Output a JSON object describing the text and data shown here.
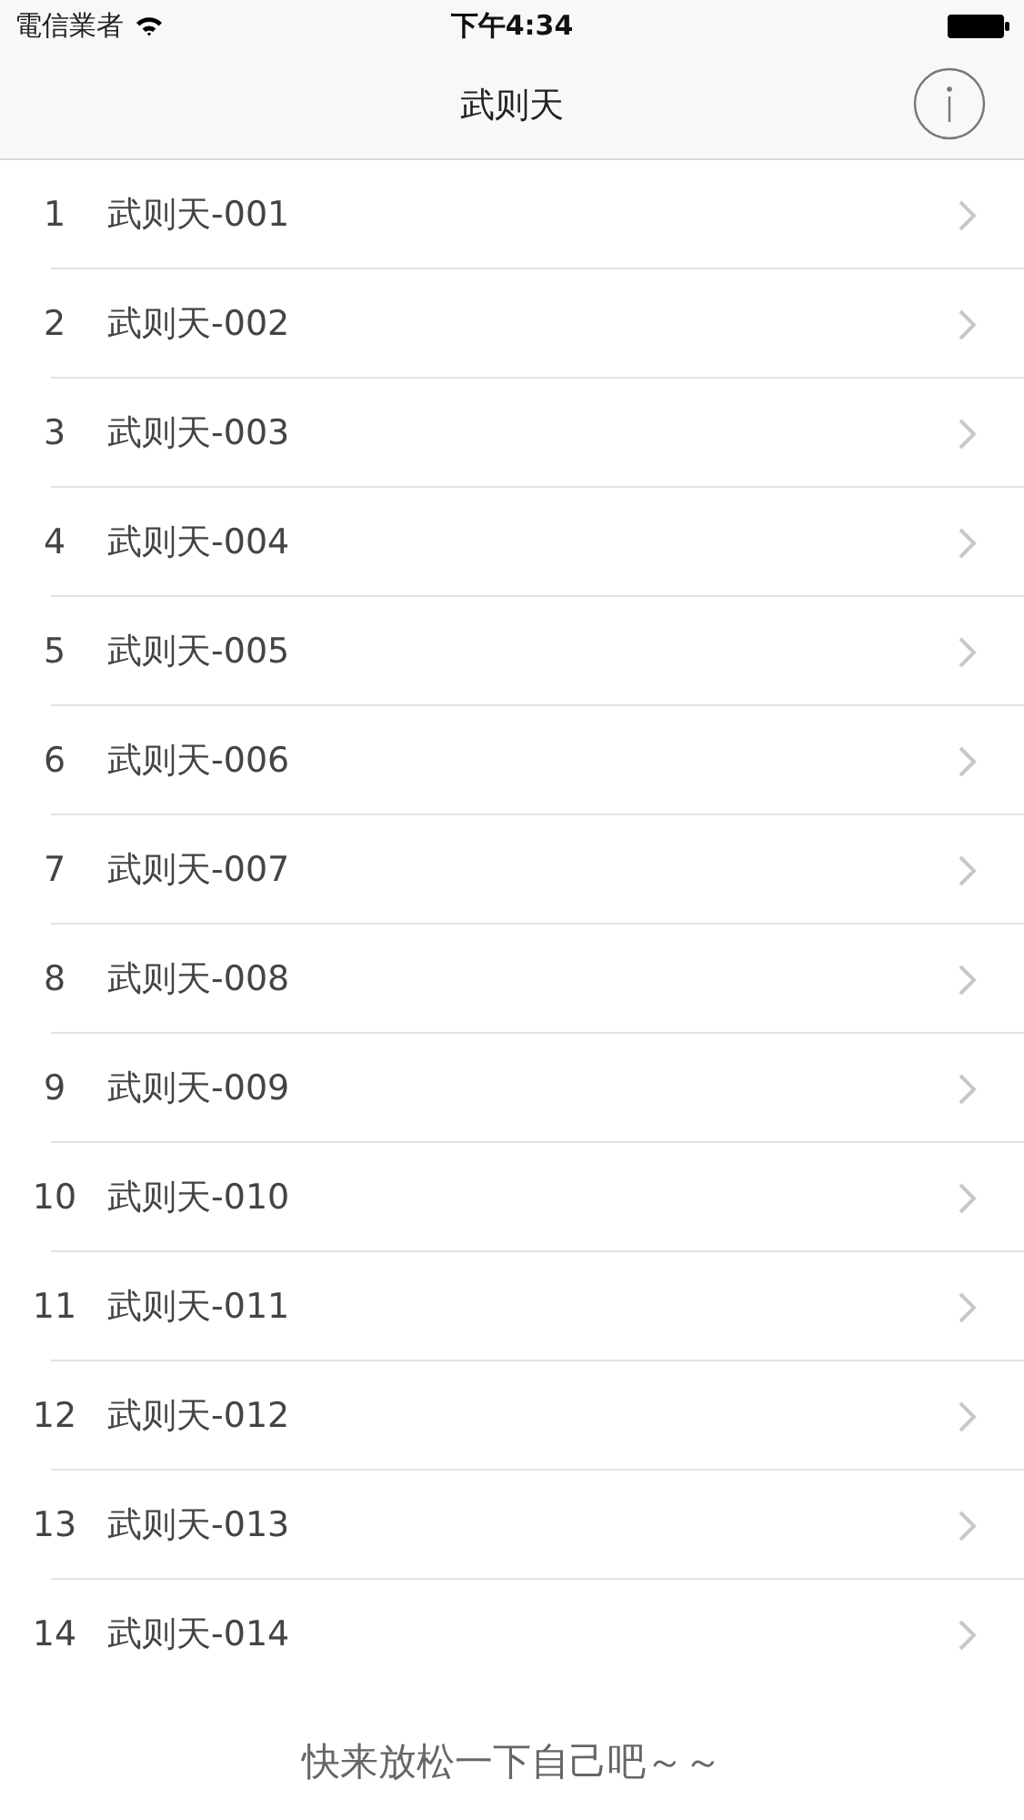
{
  "status_bar": {
    "carrier": "電信業者",
    "time": "下午4:34"
  },
  "nav_bar": {
    "title": "武则天"
  },
  "list": {
    "rows": [
      {
        "index": "1",
        "title": "武则天-001"
      },
      {
        "index": "2",
        "title": "武则天-002"
      },
      {
        "index": "3",
        "title": "武则天-003"
      },
      {
        "index": "4",
        "title": "武则天-004"
      },
      {
        "index": "5",
        "title": "武则天-005"
      },
      {
        "index": "6",
        "title": "武则天-006"
      },
      {
        "index": "7",
        "title": "武则天-007"
      },
      {
        "index": "8",
        "title": "武则天-008"
      },
      {
        "index": "9",
        "title": "武则天-009"
      },
      {
        "index": "10",
        "title": "武则天-010"
      },
      {
        "index": "11",
        "title": "武则天-011"
      },
      {
        "index": "12",
        "title": "武则天-012"
      },
      {
        "index": "13",
        "title": "武则天-013"
      },
      {
        "index": "14",
        "title": "武则天-014"
      }
    ]
  },
  "footer": "快来放松一下自己吧～～"
}
